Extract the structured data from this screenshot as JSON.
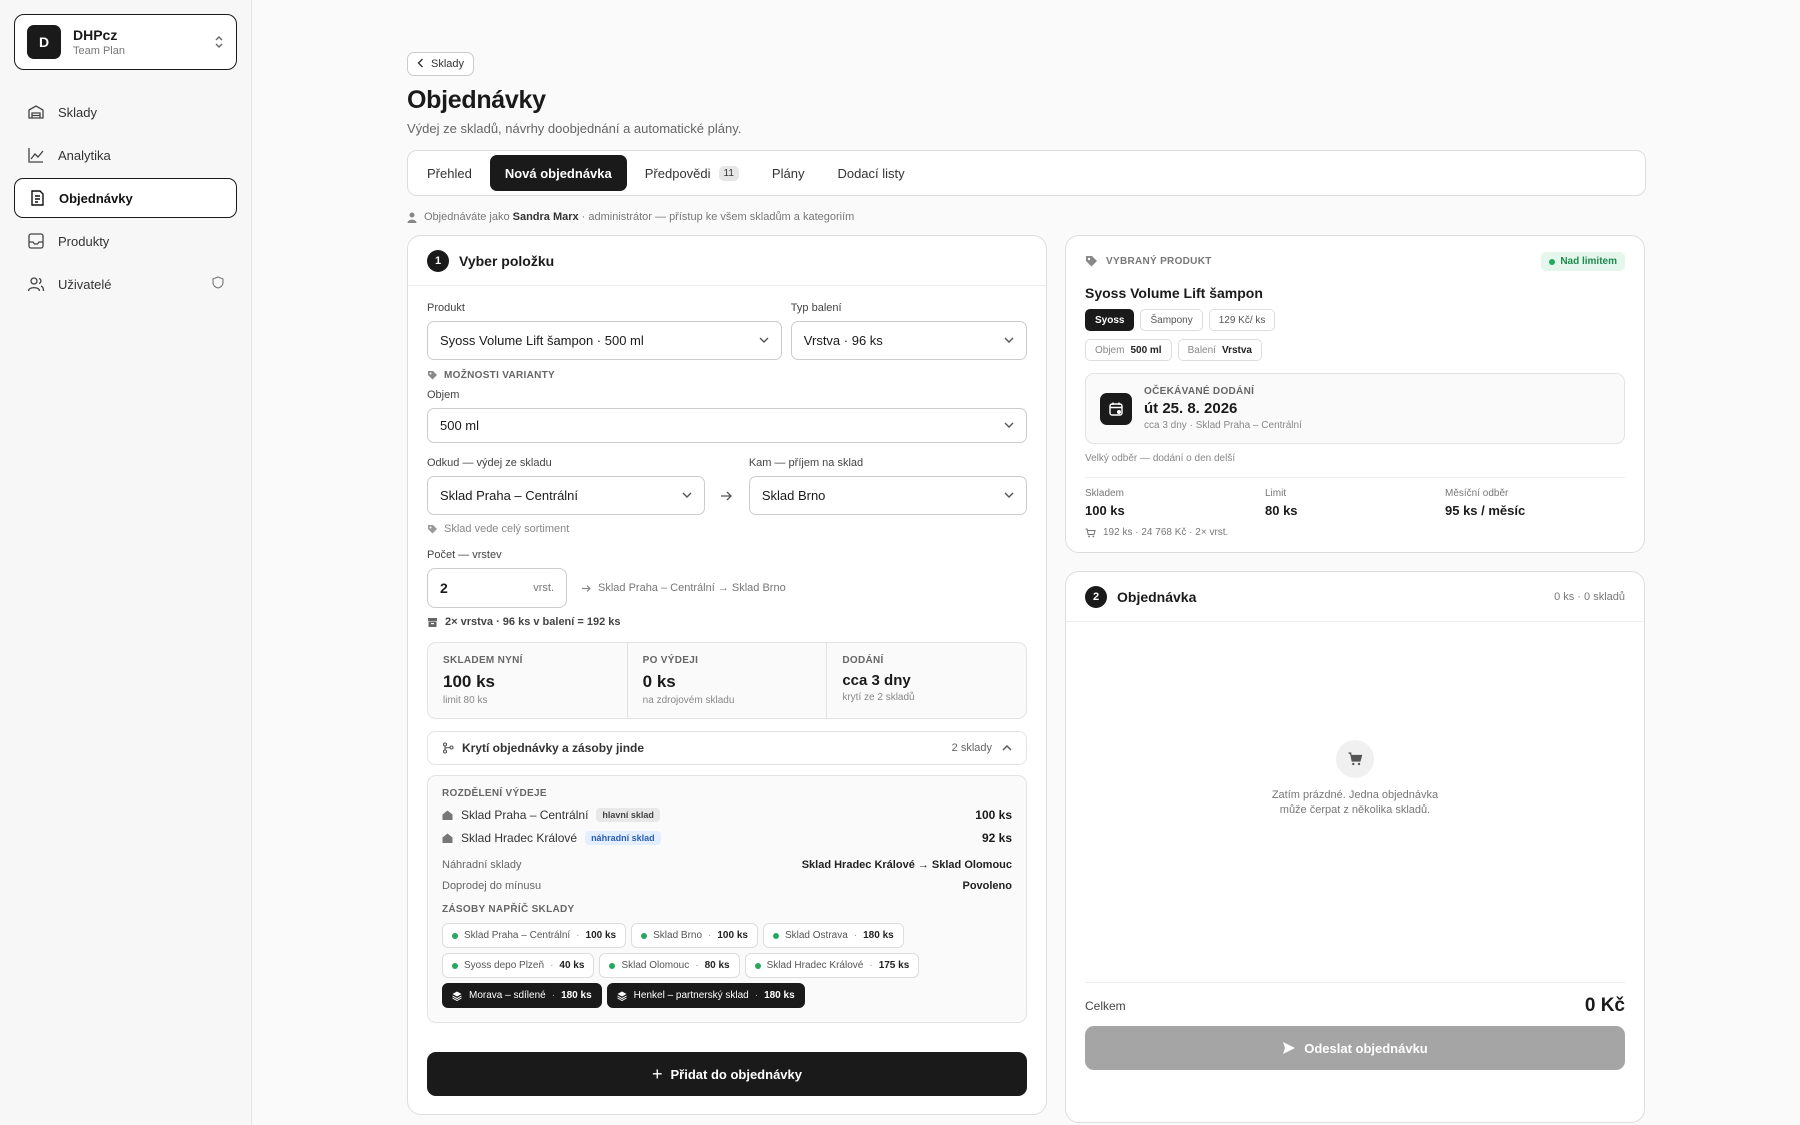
{
  "team": {
    "initial": "D",
    "name": "DHPcz",
    "plan": "Team Plan"
  },
  "nav": [
    {
      "label": "Sklady",
      "icon": "warehouse-icon"
    },
    {
      "label": "Analytika",
      "icon": "chart-line-icon"
    },
    {
      "label": "Objednávky",
      "icon": "orders-icon",
      "active": true
    },
    {
      "label": "Produkty",
      "icon": "inbox-icon"
    },
    {
      "label": "Uživatelé",
      "icon": "users-icon"
    }
  ],
  "header": {
    "back_label": "Sklady",
    "title": "Objednávky",
    "subtitle": "Výdej ze skladů, návrhy doobjednání a automatické plány."
  },
  "tabs": [
    {
      "label": "Přehled"
    },
    {
      "label": "Nová objednávka",
      "active": true
    },
    {
      "label": "Předpovědi",
      "badge": "11"
    },
    {
      "label": "Plány"
    },
    {
      "label": "Dodací listy"
    }
  ],
  "ordering_as": {
    "prefix": "Objednáváte jako",
    "user": "Sandra Marx",
    "suffix": "· administrátor — přístup ke všem skladům a kategoriím"
  },
  "step1": {
    "num": "1",
    "title": "Vyber položku",
    "product_label": "Produkt",
    "product_value": "Syoss Volume Lift šampon · 500 ml",
    "packaging_label": "Typ balení",
    "packaging_value": "Vrstva · 96 ks",
    "variant_heading": "MOŽNOSTI VARIANTY",
    "volume_label": "Objem",
    "volume_value": "500 ml",
    "from_label": "Odkud — výdej ze skladu",
    "from_value": "Sklad Praha – Centrální",
    "to_label": "Kam — příjem na sklad",
    "to_value": "Sklad Brno",
    "assortment_hint": "Sklad vede celý sortiment",
    "qty_label": "Počet — vrstev",
    "qty_value": "2",
    "qty_unit": "vrst.",
    "route": "Sklad Praha – Centrální → Sklad Brno",
    "calc": "2× vrstva · 96 ks v balení = 192 ks",
    "stats": [
      {
        "label": "SKLADEM NYNÍ",
        "value": "100 ks",
        "sub": "limit 80 ks"
      },
      {
        "label": "PO VÝDEJI",
        "value": "0 ks",
        "sub": "na zdrojovém skladu"
      },
      {
        "label": "DODÁNÍ",
        "value": "cca 3 dny",
        "sub": "krytí ze 2 skladů"
      }
    ],
    "coverage_label": "Krytí objednávky a zásoby jinde",
    "coverage_count": "2 sklady",
    "split_heading": "ROZDĚLENÍ VÝDEJE",
    "split_rows": [
      {
        "name": "Sklad Praha – Centrální",
        "tag": "hlavní sklad",
        "tag_style": "grey",
        "qty": "100 ks"
      },
      {
        "name": "Sklad Hradec Králové",
        "tag": "náhradní sklad",
        "tag_style": "blue",
        "qty": "92 ks"
      }
    ],
    "backup_label": "Náhradní sklady",
    "backup_value": "Sklad Hradec Králové → Sklad Olomouc",
    "negative_label": "Doprodej do mínusu",
    "negative_value": "Povoleno",
    "stock_heading": "ZÁSOBY NAPŘÍČ SKLADY",
    "stock_chips": [
      {
        "name": "Sklad Praha – Centrální",
        "qty": "100 ks"
      },
      {
        "name": "Sklad Brno",
        "qty": "100 ks"
      },
      {
        "name": "Sklad Ostrava",
        "qty": "180 ks"
      },
      {
        "name": "Syoss depo Plzeň",
        "qty": "40 ks"
      },
      {
        "name": "Sklad Olomouc",
        "qty": "80 ks"
      },
      {
        "name": "Sklad Hradec Králové",
        "qty": "175 ks"
      }
    ],
    "shared_chips": [
      {
        "name": "Morava – sdílené",
        "qty": "180 ks"
      },
      {
        "name": "Henkel – partnerský sklad",
        "qty": "180 ks"
      }
    ],
    "add_button": "Přidat do objednávky"
  },
  "product": {
    "heading": "VYBRANÝ PRODUKT",
    "status": "Nad limitem",
    "name": "Syoss Volume Lift šampon",
    "tags": [
      "Syoss",
      "Šampony",
      "129 Kč/ ks"
    ],
    "volume_key": "Objem",
    "volume_val": "500 ml",
    "pack_key": "Balení",
    "pack_val": "Vrstva",
    "delivery_label": "OČEKÁVANÉ DODÁNÍ",
    "delivery_date": "út 25. 8. 2026",
    "delivery_sub": "cca 3 dny · Sklad Praha – Centrální",
    "note": "Velký odběr — dodání o den delší",
    "stock_label": "Skladem",
    "stock_value": "100 ks",
    "limit_label": "Limit",
    "limit_value": "80 ks",
    "monthly_label": "Měsíční odběr",
    "monthly_value": "95 ks / měsíc",
    "footer": "192 ks · 24 768 Kč · 2× vrst.",
    "colors": {
      "ok": "#25a85e"
    }
  },
  "order": {
    "num": "2",
    "title": "Objednávka",
    "count": "0 ks · 0 skladů",
    "empty_line1": "Zatím prázdné. Jedna objednávka",
    "empty_line2": "může čerpat z několika skladů.",
    "total_label": "Celkem",
    "total_value": "0 Kč",
    "send_button": "Odeslat objednávku"
  }
}
